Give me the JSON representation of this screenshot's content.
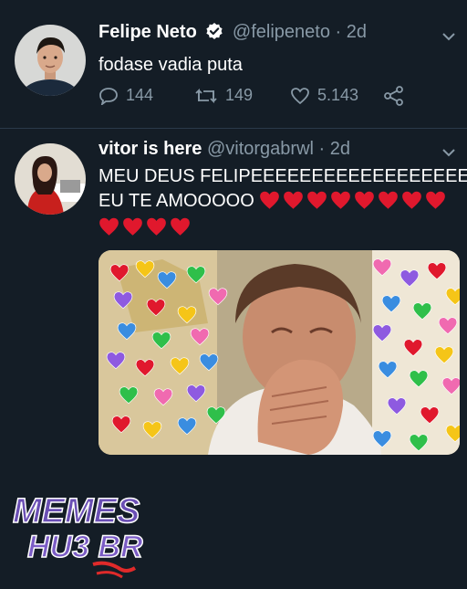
{
  "tweets": [
    {
      "name": "Felipe Neto",
      "handle": "@felipeneto",
      "time": "· 2d",
      "text": "fodase vadia puta",
      "verified": true,
      "replies": "144",
      "retweets": "149",
      "likes": "5.143"
    },
    {
      "name": "vitor is here",
      "handle": "@vitorgabrwl",
      "time": "· 2d",
      "text_line1": "MEU DEUS FELIPEEEEEEEEEEEEEEEEEEE",
      "text_line2": "EU TE AMOOOOO"
    }
  ],
  "watermark": {
    "line1": "MEMES",
    "line2": "HU3 BR"
  },
  "colors": {
    "background": "#141d26",
    "muted": "#8899a6",
    "heart": "#e0182d",
    "divider": "#2b3a4a"
  },
  "icons": {
    "reply": "reply-icon",
    "retweet": "retweet-icon",
    "like": "like-icon",
    "share": "share-icon",
    "verified": "verified-badge-icon",
    "more": "chevron-down-icon"
  }
}
